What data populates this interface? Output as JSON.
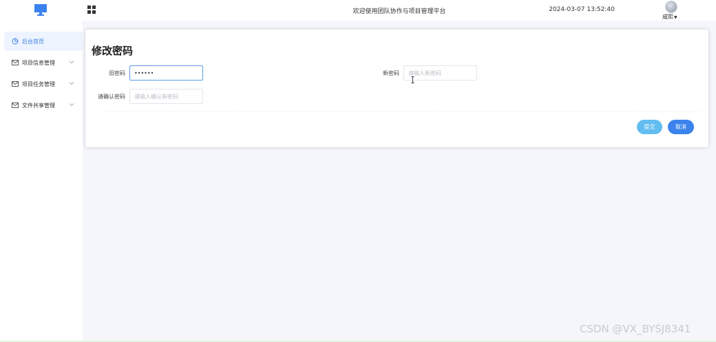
{
  "header": {
    "logo_icon": "monitor-icon",
    "menu_toggle_icon": "grid-icon",
    "platform_title": "欢迎使用团队协作与项目管理平台",
    "datetime": "2024-03-07 13:52:40",
    "user": {
      "avatar_icon": "avatar-icon",
      "name": "咸熙",
      "caret_icon": "chevron-down-icon"
    }
  },
  "sidebar": {
    "items": [
      {
        "label": "后台首页",
        "icon": "pie-chart-icon",
        "active": true,
        "has_submenu": false
      },
      {
        "label": "项目信息管理",
        "icon": "mail-icon",
        "active": false,
        "has_submenu": true
      },
      {
        "label": "项目任务管理",
        "icon": "mail-icon",
        "active": false,
        "has_submenu": true
      },
      {
        "label": "文件共享管理",
        "icon": "mail-icon",
        "active": false,
        "has_submenu": true
      }
    ]
  },
  "form": {
    "title": "修改密码",
    "old_password": {
      "label": "旧密码",
      "value": "••••••"
    },
    "new_password": {
      "label": "新密码",
      "placeholder": "请输入新密码"
    },
    "confirm_password": {
      "label": "请确认密码",
      "placeholder": "请输入确认新密码"
    },
    "submit_label": "提交",
    "cancel_label": "取消"
  },
  "watermark": "CSDN @VX_BYSJ8341",
  "colors": {
    "accent": "#3a82ec",
    "submit": "#62bdf0",
    "active_menu_bg": "#eef4ff",
    "page_bg": "#f4f6fb"
  }
}
